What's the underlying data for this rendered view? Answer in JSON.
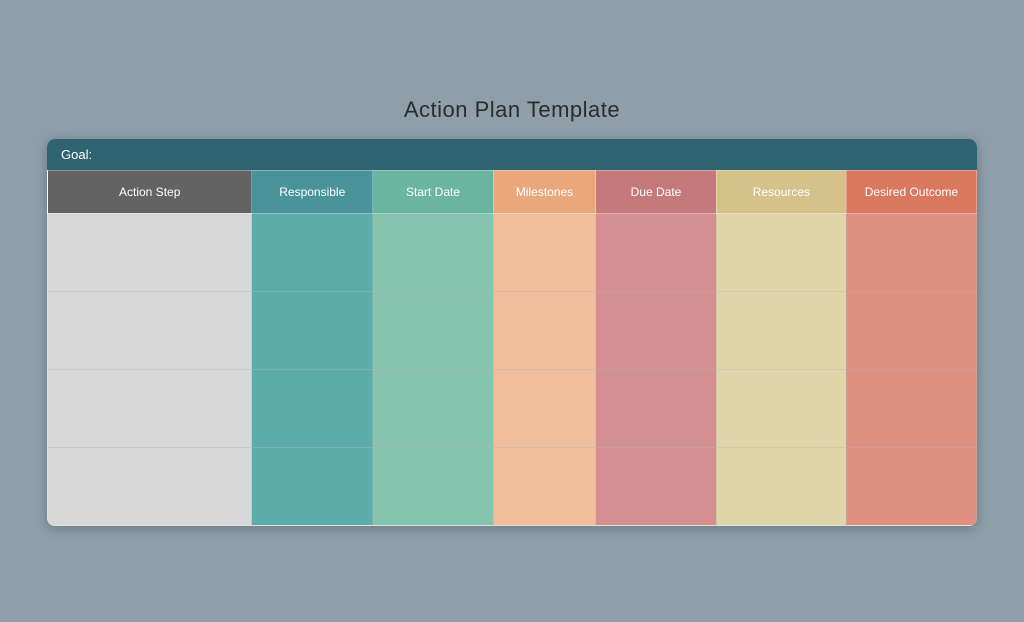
{
  "page": {
    "title": "Action Plan Template"
  },
  "goal_bar": {
    "label": "Goal:"
  },
  "columns": [
    {
      "id": "action-step",
      "label": "Action Step",
      "header_class": "col-action-step",
      "cell_class": "cell-action-step"
    },
    {
      "id": "responsible",
      "label": "Responsible",
      "header_class": "col-responsible",
      "cell_class": "cell-responsible"
    },
    {
      "id": "start-date",
      "label": "Start Date",
      "header_class": "col-start-date",
      "cell_class": "cell-start-date"
    },
    {
      "id": "milestones",
      "label": "Milestones",
      "header_class": "col-milestones",
      "cell_class": "cell-milestones"
    },
    {
      "id": "due-date",
      "label": "Due Date",
      "header_class": "col-due-date",
      "cell_class": "cell-due-date"
    },
    {
      "id": "resources",
      "label": "Resources",
      "header_class": "col-resources",
      "cell_class": "cell-resources"
    },
    {
      "id": "desired-outcome",
      "label": "Desired Outcome",
      "header_class": "col-desired",
      "cell_class": "cell-desired"
    }
  ],
  "rows": [
    {},
    {},
    {},
    {}
  ]
}
